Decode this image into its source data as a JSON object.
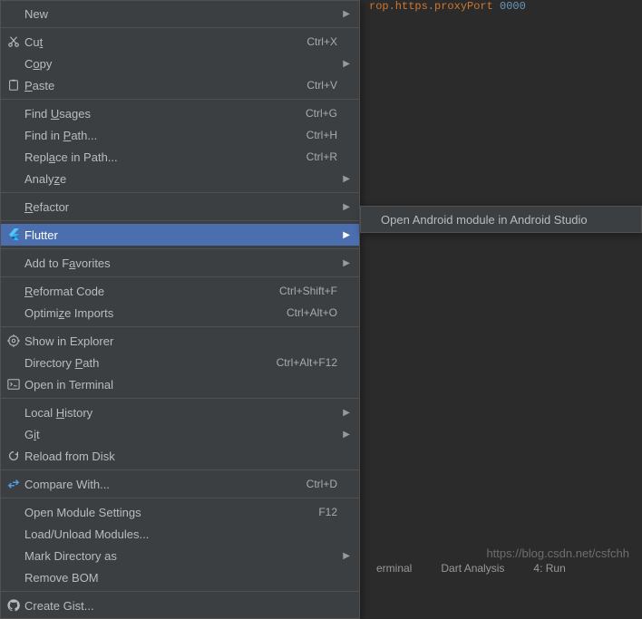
{
  "editor_snippet": {
    "prefix": "rop.https.proxyPort",
    "value": "0000"
  },
  "menu": {
    "items": [
      {
        "label_html": "New",
        "shortcut": "",
        "arrow": true,
        "icon": null
      },
      "sep",
      {
        "label_html": "Cu<u>t</u>",
        "shortcut": "Ctrl+X",
        "arrow": false,
        "icon": "scissors"
      },
      {
        "label_html": "C<u>o</u>py",
        "shortcut": "",
        "arrow": true,
        "icon": null
      },
      {
        "label_html": "<u>P</u>aste",
        "shortcut": "Ctrl+V",
        "arrow": false,
        "icon": "clipboard"
      },
      "sep",
      {
        "label_html": "Find <u>U</u>sages",
        "shortcut": "Ctrl+G",
        "arrow": false,
        "icon": null
      },
      {
        "label_html": "Find in <u>P</u>ath...",
        "shortcut": "Ctrl+H",
        "arrow": false,
        "icon": null
      },
      {
        "label_html": "Repl<u>a</u>ce in Path...",
        "shortcut": "Ctrl+R",
        "arrow": false,
        "icon": null
      },
      {
        "label_html": "Analy<u>z</u>e",
        "shortcut": "",
        "arrow": true,
        "icon": null
      },
      "sep",
      {
        "label_html": "<u>R</u>efactor",
        "shortcut": "",
        "arrow": true,
        "icon": null
      },
      "sep",
      {
        "label_html": "Flutter",
        "shortcut": "",
        "arrow": true,
        "icon": "flutter",
        "highlighted": true
      },
      "sep",
      {
        "label_html": "Add to F<u>a</u>vorites",
        "shortcut": "",
        "arrow": true,
        "icon": null
      },
      "sep",
      {
        "label_html": "<u>R</u>eformat Code",
        "shortcut": "Ctrl+Shift+F",
        "arrow": false,
        "icon": null
      },
      {
        "label_html": "Optimi<u>z</u>e Imports",
        "shortcut": "Ctrl+Alt+O",
        "arrow": false,
        "icon": null
      },
      "sep",
      {
        "label_html": "Show in Explorer",
        "shortcut": "",
        "arrow": false,
        "icon": "target"
      },
      {
        "label_html": "Directory <u>P</u>ath",
        "shortcut": "Ctrl+Alt+F12",
        "arrow": false,
        "icon": null
      },
      {
        "label_html": "Open in Terminal",
        "shortcut": "",
        "arrow": false,
        "icon": "terminal"
      },
      "sep",
      {
        "label_html": "Local <u>H</u>istory",
        "shortcut": "",
        "arrow": true,
        "icon": null
      },
      {
        "label_html": "G<u>i</u>t",
        "shortcut": "",
        "arrow": true,
        "icon": null
      },
      {
        "label_html": "Reload from Disk",
        "shortcut": "",
        "arrow": false,
        "icon": "reload"
      },
      "sep",
      {
        "label_html": "Compare With...",
        "shortcut": "Ctrl+D",
        "arrow": false,
        "icon": "compare"
      },
      "sep",
      {
        "label_html": "Open Module Settings",
        "shortcut": "F12",
        "arrow": false,
        "icon": null
      },
      {
        "label_html": "Load/Unload Modules...",
        "shortcut": "",
        "arrow": false,
        "icon": null
      },
      {
        "label_html": "Mark Directory as",
        "shortcut": "",
        "arrow": true,
        "icon": null
      },
      {
        "label_html": "Remove BOM",
        "shortcut": "",
        "arrow": false,
        "icon": null
      },
      "sep",
      {
        "label_html": "Create Gist...",
        "shortcut": "",
        "arrow": false,
        "icon": "github"
      }
    ]
  },
  "submenu": {
    "item": "Open Android module in Android Studio"
  },
  "watermark": "https://blog.csdn.net/csfchh",
  "bottom_bar": {
    "a": "erminal",
    "b": "Dart Analysis",
    "c": "4: Run"
  }
}
